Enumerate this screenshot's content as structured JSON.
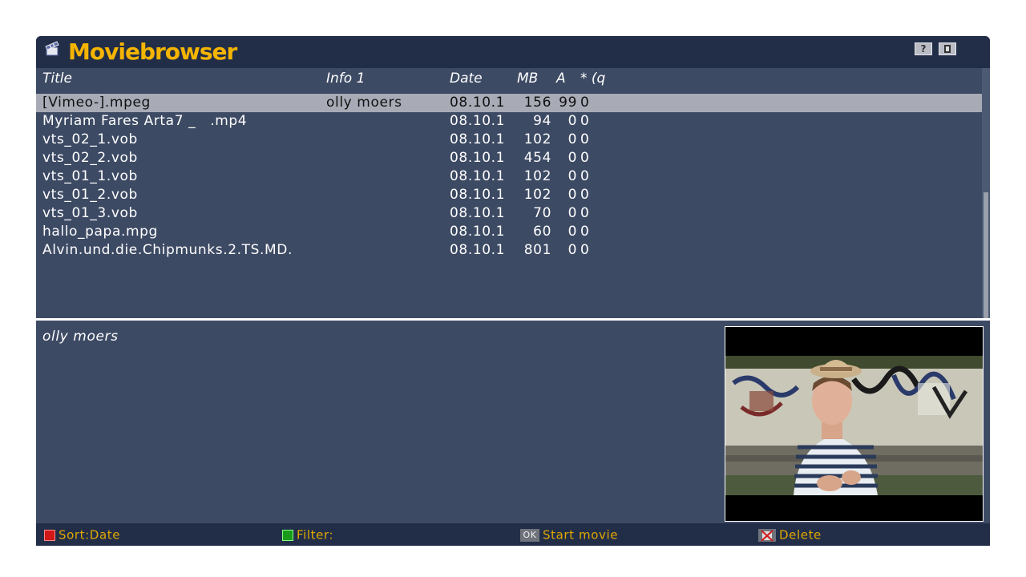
{
  "app": {
    "title": "Moviebrowser",
    "help_label": "?",
    "icon": "clapperboard-icon"
  },
  "columns": {
    "title": "Title",
    "info": "Info 1",
    "date": "Date",
    "mb": "MB",
    "a": "A",
    "q": "* (q"
  },
  "movies": [
    {
      "title": "[Vimeo-].mpeg",
      "info": "olly moers",
      "date": "08.10.1",
      "mb": "156",
      "a": "99",
      "q": "0",
      "selected": true
    },
    {
      "title": "Myriam Fares Arta7 _   .mp4",
      "info": "",
      "date": "08.10.1",
      "mb": "94",
      "a": "0",
      "q": "0"
    },
    {
      "title": "vts_02_1.vob",
      "info": "",
      "date": "08.10.1",
      "mb": "102",
      "a": "0",
      "q": "0"
    },
    {
      "title": "vts_02_2.vob",
      "info": "",
      "date": "08.10.1",
      "mb": "454",
      "a": "0",
      "q": "0"
    },
    {
      "title": "vts_01_1.vob",
      "info": "",
      "date": "08.10.1",
      "mb": "102",
      "a": "0",
      "q": "0"
    },
    {
      "title": "vts_01_2.vob",
      "info": "",
      "date": "08.10.1",
      "mb": "102",
      "a": "0",
      "q": "0"
    },
    {
      "title": "vts_01_3.vob",
      "info": "",
      "date": "08.10.1",
      "mb": "70",
      "a": "0",
      "q": "0"
    },
    {
      "title": "hallo_papa.mpg",
      "info": "",
      "date": "08.10.1",
      "mb": "60",
      "a": "0",
      "q": "0"
    },
    {
      "title": "Alvin.und.die.Chipmunks.2.TS.MD.",
      "info": "",
      "date": "08.10.1",
      "mb": "801",
      "a": "0",
      "q": "0"
    }
  ],
  "details": {
    "info_text": "olly moers",
    "thumbnail": "video-thumbnail-image"
  },
  "footer": {
    "sort_label": "Sort:Date",
    "filter_label": "Filter:",
    "ok_key": "OK",
    "start_label": "Start movie",
    "delete_label": "Delete"
  },
  "colors": {
    "accent": "#f5b400",
    "panel": "#3d4a64",
    "header": "#222e48",
    "selected": "#a8abb5"
  }
}
